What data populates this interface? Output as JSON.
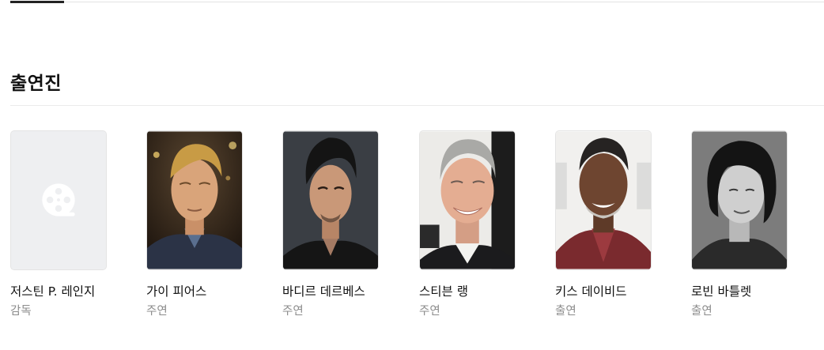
{
  "section": {
    "title": "출연진"
  },
  "cast": [
    {
      "name": "저스틴 P. 레인지",
      "role": "감독",
      "photo": "placeholder-film-reel"
    },
    {
      "name": "가이 피어스",
      "role": "주연",
      "photo": "portrait"
    },
    {
      "name": "바디르 데르베스",
      "role": "주연",
      "photo": "portrait"
    },
    {
      "name": "스티븐 랭",
      "role": "주연",
      "photo": "portrait"
    },
    {
      "name": "키스 데이비드",
      "role": "출연",
      "photo": "portrait"
    },
    {
      "name": "로빈 바틀렛",
      "role": "출연",
      "photo": "portrait"
    }
  ]
}
